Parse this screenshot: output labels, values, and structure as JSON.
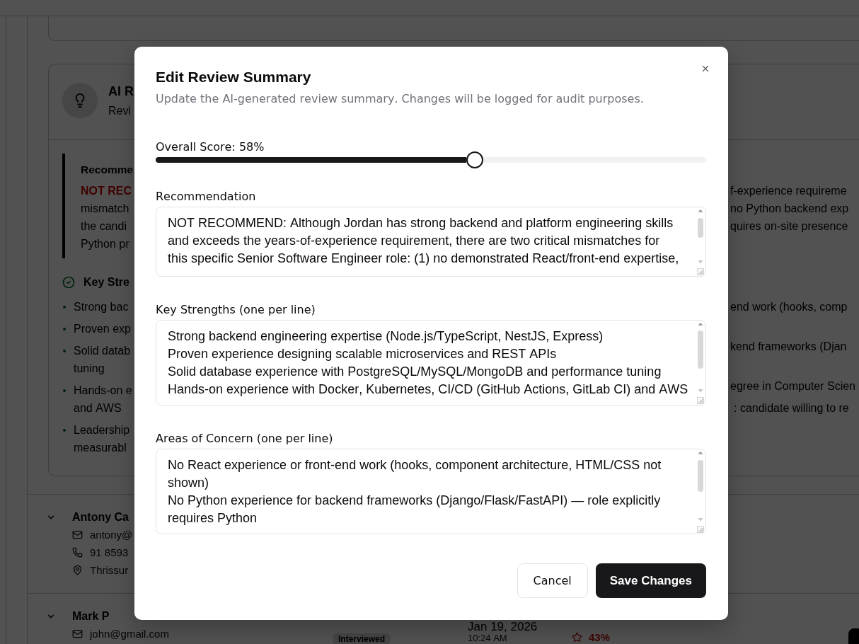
{
  "background": {
    "review_card": {
      "title": "AI R",
      "subtitle": "Revi",
      "recommendation": {
        "heading": "Recomme",
        "verdict": "NOT REC",
        "left_lines": [
          "mismatch",
          "the candi",
          "Python pr"
        ],
        "right_lines": [
          "f-experience requireme",
          "no Python backend exp",
          "quires on-site presence"
        ]
      },
      "strengths": {
        "heading": "Key Stre",
        "items": [
          {
            "lines": [
              "Strong bac"
            ]
          },
          {
            "lines": [
              "Proven exp"
            ]
          },
          {
            "lines": [
              "Solid datab",
              "tuning"
            ]
          },
          {
            "lines": [
              "Hands-on e",
              "and AWS"
            ]
          },
          {
            "lines": [
              "Leadership",
              "measurabl"
            ]
          }
        ]
      },
      "concerns": {
        "items": [
          "end work (hooks, comp",
          "kend frameworks (Djan",
          "egree in Computer Scien",
          ": candidate willing to re"
        ]
      }
    },
    "candidates": [
      {
        "name": "Antony Ca",
        "contacts": [
          {
            "kind": "email",
            "text": "antony@"
          },
          {
            "kind": "phone",
            "text": "91 8593"
          },
          {
            "kind": "location",
            "text": "Thrissur"
          }
        ]
      },
      {
        "name": "Mark P",
        "contacts": [
          {
            "kind": "email",
            "text": "john@gmail.com"
          }
        ],
        "status": "Interviewed",
        "date": "Jan 19, 2026",
        "time": "10:24 AM",
        "score": "43%"
      }
    ]
  },
  "dialog": {
    "title": "Edit Review Summary",
    "description": "Update the AI-generated review summary. Changes will be logged for audit purposes.",
    "score": {
      "label": "Overall Score: 58%",
      "level": 0.58
    },
    "fields": [
      {
        "label": "Recommendation",
        "lines": [
          "NOT RECOMMEND: Although Jordan has strong backend and platform engineering skills and exceeds the years-of-experience requirement, there are two critical mismatches for this specific Senior Software Engineer role: (1) no demonstrated React/front-end expertise,"
        ]
      },
      {
        "label": "Key Strengths (one per line)",
        "lines": [
          "Strong backend engineering expertise (Node.js/TypeScript, NestJS, Express)",
          "Proven experience designing scalable microservices and REST APIs",
          "Solid database experience with PostgreSQL/MySQL/MongoDB and performance tuning",
          "Hands-on experience with Docker, Kubernetes, CI/CD (GitHub Actions, GitLab CI) and AWS"
        ]
      },
      {
        "label": "Areas of Concern (one per line)",
        "lines": [
          "No React experience or front-end work (hooks, component architecture, HTML/CSS not shown)",
          "No Python experience for backend frameworks (Django/Flask/FastAPI) — role explicitly requires Python"
        ]
      }
    ],
    "buttons": [
      {
        "label": "Cancel",
        "kind": "cancel"
      },
      {
        "label": "Save Changes",
        "kind": "save"
      }
    ]
  }
}
